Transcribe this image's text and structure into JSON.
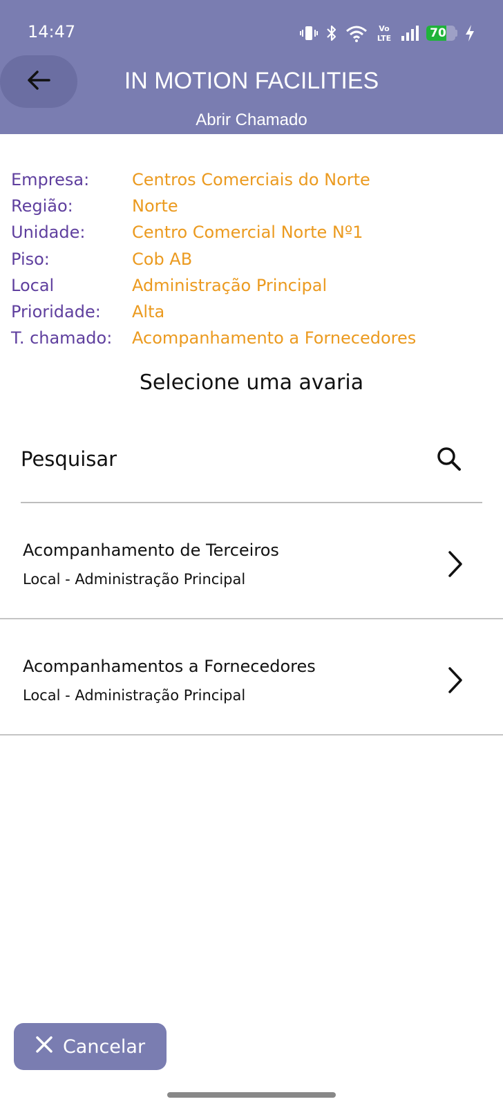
{
  "status_bar": {
    "time": "14:47",
    "battery": "70",
    "battery_level": 0.7,
    "network_label_top": "Vo",
    "network_label_bottom": "LTE",
    "icons": [
      "vibrate-icon",
      "bluetooth-icon",
      "wifi-icon",
      "volte-icon",
      "signal-icon",
      "battery-icon",
      "charging-icon"
    ]
  },
  "header": {
    "back_icon": "arrow-left-icon",
    "title": "IN MOTION FACILITIES",
    "subtitle": "Abrir Chamado",
    "color": "#7a7db1"
  },
  "info": {
    "rows": [
      {
        "label": "Empresa:",
        "value": "Centros Comerciais do Norte"
      },
      {
        "label": "Região:",
        "value": "Norte"
      },
      {
        "label": "Unidade:",
        "value": "Centro Comercial Norte Nº1"
      },
      {
        "label": "Piso:",
        "value": "Cob AB"
      },
      {
        "label": "Local",
        "value": "Administração Principal"
      },
      {
        "label": "Prioridade:",
        "value": "Alta"
      },
      {
        "label": "T. chamado:",
        "value": "Acompanhamento a Fornecedores"
      }
    ],
    "label_color": "#5f3f9e",
    "value_color": "#eb9a1f"
  },
  "section_title": "Selecione uma avaria",
  "search": {
    "placeholder": "Pesquisar",
    "value": "",
    "icon": "search-icon"
  },
  "list": {
    "items": [
      {
        "title": "Acompanhamento de Terceiros",
        "subtitle": "Local - Administração Principal",
        "icon": "chevron-right-icon"
      },
      {
        "title": "Acompanhamentos a Fornecedores",
        "subtitle": "Local - Administração Principal",
        "icon": "chevron-right-icon"
      }
    ]
  },
  "footer": {
    "cancel_label": "Cancelar",
    "cancel_icon": "close-icon"
  }
}
